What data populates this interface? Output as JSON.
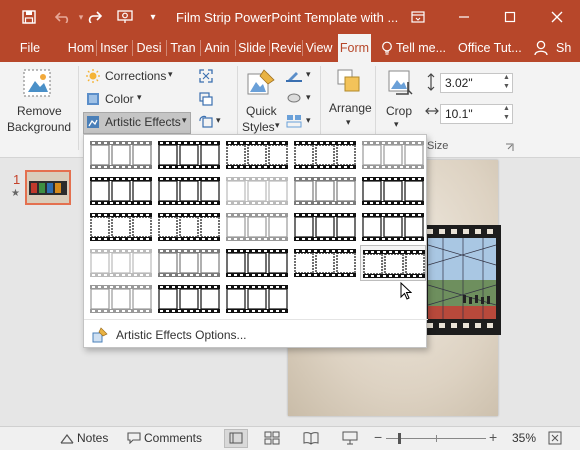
{
  "window": {
    "title": "Film Strip PowerPoint Template with ...",
    "quick_access": [
      "save-icon",
      "undo-icon",
      "redo-icon",
      "slideshow-icon",
      "customize-icon"
    ],
    "controls": [
      "ribbon-display-icon",
      "minimize-icon",
      "restore-icon",
      "close-icon"
    ]
  },
  "tabs": [
    {
      "label": "File"
    },
    {
      "label": "Hom"
    },
    {
      "label": "Inser"
    },
    {
      "label": "Desi"
    },
    {
      "label": "Tran"
    },
    {
      "label": "Anin"
    },
    {
      "label": "Slide"
    },
    {
      "label": "Revie"
    },
    {
      "label": "View"
    },
    {
      "label": "Form",
      "active": true
    },
    {
      "label": "Tell me..."
    },
    {
      "label": "Office Tut..."
    },
    {
      "label": "Sh"
    }
  ],
  "ribbon": {
    "remove_background": [
      "Remove",
      "Background"
    ],
    "corrections": "Corrections",
    "color": "Color",
    "artistic_effects": "Artistic Effects",
    "quick_styles": [
      "Quick",
      "Styles"
    ],
    "arrange": "Arrange",
    "crop": "Crop",
    "height": "3.02\"",
    "width": "10.1\"",
    "size_group": "Size"
  },
  "gallery": {
    "rows": 5,
    "cols": 5,
    "count": 23,
    "selected_index": 19,
    "footer": "Artistic Effects Options..."
  },
  "thumbnails": {
    "slide_number": "1",
    "star": "★"
  },
  "statusbar": {
    "notes": "Notes",
    "comments": "Comments",
    "zoom": "35%",
    "zoom_level": 0.35
  },
  "colors": {
    "accent": "#b7472a",
    "ribbon": "#f3f3f3",
    "workspace": "#e6e6e6"
  }
}
